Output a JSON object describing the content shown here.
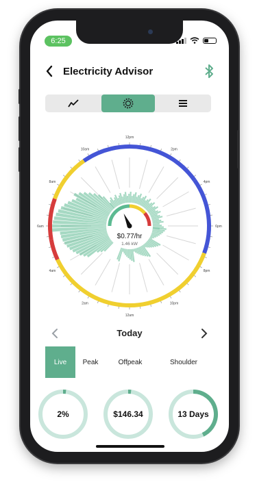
{
  "status": {
    "time": "6:25"
  },
  "header": {
    "title": "Electricity Advisor",
    "back_icon": "chevron-left-icon",
    "bluetooth_icon": "bluetooth-icon"
  },
  "segments": [
    {
      "icon": "line-chart-icon",
      "active": false
    },
    {
      "icon": "dial-icon",
      "active": true
    },
    {
      "icon": "list-icon",
      "active": false
    }
  ],
  "dial": {
    "center_value": "$0.77/hr",
    "center_sub": "1.46 kW",
    "hour_labels": [
      "12am",
      "2am",
      "4am",
      "6am",
      "8am",
      "10am",
      "12pm",
      "2pm",
      "4pm",
      "6pm",
      "8pm",
      "10pm"
    ],
    "top_label": "12pm",
    "bottom_label": "12pm",
    "colors": {
      "peak": "#d63c3c",
      "offpeak": "#4455d6",
      "shoulder": "#f0cf2f",
      "usage": "#5cba92"
    }
  },
  "day_nav": {
    "label": "Today",
    "prev_icon": "chevron-left-icon",
    "next_icon": "chevron-right-icon"
  },
  "tabs": [
    {
      "label": "Live",
      "active": true
    },
    {
      "label": "Peak",
      "active": false
    },
    {
      "label": "Offpeak",
      "active": false
    },
    {
      "label": "Shoulder",
      "active": false
    }
  ],
  "rings": [
    {
      "label": "2%",
      "progress": 0.02
    },
    {
      "label": "$146.34",
      "progress": 0.02
    },
    {
      "label": "13 Days",
      "progress": 0.43
    }
  ],
  "accent": "#5fae8d"
}
